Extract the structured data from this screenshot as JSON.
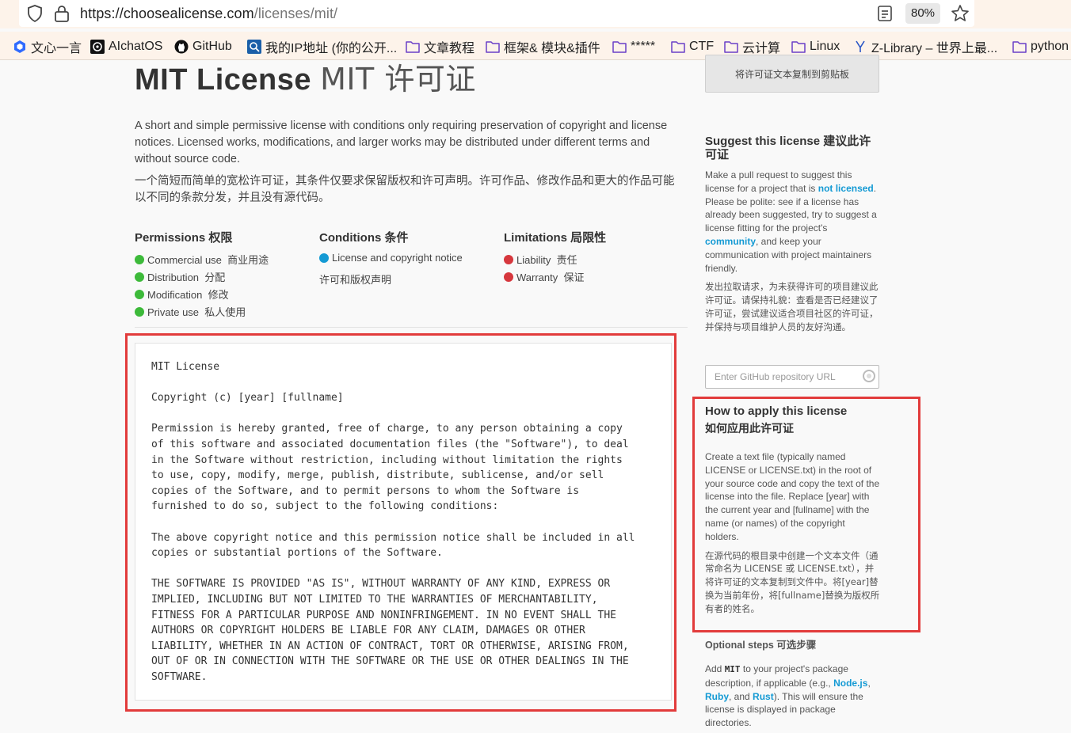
{
  "browser": {
    "url_host": "https://choosealicense.com",
    "url_path": "/licenses/mit/",
    "zoom": "80%"
  },
  "bookmarks": [
    {
      "label": "文心一言",
      "icon": "wenxin-icon"
    },
    {
      "label": "AIchatOS",
      "icon": "openai-icon"
    },
    {
      "label": "GitHub",
      "icon": "github-icon"
    },
    {
      "label": "我的IP地址 (你的公开...",
      "icon": "ip-icon"
    },
    {
      "label": "文章教程",
      "icon": "folder-icon"
    },
    {
      "label": "框架& 模块&插件",
      "icon": "folder-icon"
    },
    {
      "label": "*****",
      "icon": "folder-icon"
    },
    {
      "label": "CTF",
      "icon": "folder-icon"
    },
    {
      "label": "云计算",
      "icon": "folder-icon"
    },
    {
      "label": "Linux",
      "icon": "folder-icon"
    },
    {
      "label": "Z-Library – 世界上最...",
      "icon": "zlib-icon"
    },
    {
      "label": "python",
      "icon": "folder-icon"
    }
  ],
  "page": {
    "title": "MIT License",
    "title_cn": "MIT 许可证",
    "copy_button": "将许可证文本复制到剪贴板",
    "description": "A short and simple permissive license with conditions only requiring preservation of copyright and license notices. Licensed works, modifications, and larger works may be distributed under different terms and without source code.",
    "description_cn": "一个简短而简单的宽松许可证，其条件仅要求保留版权和许可声明。许可作品、修改作品和更大的作品可能以不同的条款分发，并且没有源代码。",
    "permissions": {
      "heading": "Permissions 权限",
      "items": [
        "Commercial use  商业用途",
        "Distribution  分配",
        "Modification  修改",
        "Private use  私人使用"
      ]
    },
    "conditions": {
      "heading": "Conditions 条件",
      "items": [
        "License and copyright notice"
      ],
      "items_cn": "许可和版权声明"
    },
    "limitations": {
      "heading": "Limitations 局限性",
      "items": [
        "Liability  责任",
        "Warranty  保证"
      ]
    },
    "license_text": "MIT License\n\nCopyright (c) [year] [fullname]\n\nPermission is hereby granted, free of charge, to any person obtaining a copy\nof this software and associated documentation files (the \"Software\"), to deal\nin the Software without restriction, including without limitation the rights\nto use, copy, modify, merge, publish, distribute, sublicense, and/or sell\ncopies of the Software, and to permit persons to whom the Software is\nfurnished to do so, subject to the following conditions:\n\nThe above copyright notice and this permission notice shall be included in all\ncopies or substantial portions of the Software.\n\nTHE SOFTWARE IS PROVIDED \"AS IS\", WITHOUT WARRANTY OF ANY KIND, EXPRESS OR\nIMPLIED, INCLUDING BUT NOT LIMITED TO THE WARRANTIES OF MERCHANTABILITY,\nFITNESS FOR A PARTICULAR PURPOSE AND NONINFRINGEMENT. IN NO EVENT SHALL THE\nAUTHORS OR COPYRIGHT HOLDERS BE LIABLE FOR ANY CLAIM, DAMAGES OR OTHER\nLIABILITY, WHETHER IN AN ACTION OF CONTRACT, TORT OR OTHERWISE, ARISING FROM,\nOUT OF OR IN CONNECTION WITH THE SOFTWARE OR THE USE OR OTHER DEALINGS IN THE\nSOFTWARE."
  },
  "sidebar": {
    "suggest_heading": "Suggest this license 建议此许可证",
    "suggest_p1": "Make a pull request to suggest this license for a project that is ",
    "suggest_link1": "not licensed",
    "suggest_p2": ". Please be polite: see if a license has already been suggested, try to suggest a license fitting for the project's ",
    "suggest_link2": "community",
    "suggest_p3": ", and keep your communication with project maintainers friendly.",
    "suggest_cn": "发出拉取请求，为未获得许可的项目建议此许可证。请保持礼貌：查看是否已经建议了许可证，尝试建议适合项目社区的许可证，并保持与项目维护人员的友好沟通。",
    "repo_placeholder": "Enter GitHub repository URL",
    "apply_heading": "How to apply this license",
    "apply_heading_cn": "如何应用此许可证",
    "apply_text": "Create a text file (typically named LICENSE or LICENSE.txt) in the root of your source code and copy the text of the license into the file. Replace [year] with the current year and [fullname] with the name (or names) of the copyright holders.",
    "apply_cn": "在源代码的根目录中创建一个文本文件（通常命名为 LICENSE 或 LICENSE.txt），并将许可证的文本复制到文件中。将[year]替换为当前年份，将[fullname]替换为版权所有者的姓名。",
    "optional_heading": "Optional steps 可选步骤",
    "optional_p1": "Add ",
    "optional_code": "MIT",
    "optional_p2": " to your project's package description, if applicable (e.g., ",
    "optional_link_node": "Node.js",
    "optional_p3": ", ",
    "optional_link_ruby": "Ruby",
    "optional_p4": ", and ",
    "optional_link_rust": "Rust",
    "optional_p5": "). This will ensure the license is displayed in package directories."
  },
  "colors": {
    "permission_dot": "#3dba3a",
    "condition_dot": "#149ad4",
    "limitation_dot": "#d6373d",
    "link": "#149ad4",
    "highlight_box": "#e23b3b"
  }
}
